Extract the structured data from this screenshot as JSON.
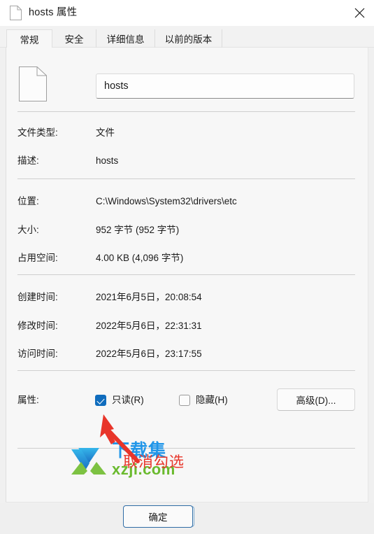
{
  "window": {
    "title": "hosts 属性",
    "title_icon": "document-icon",
    "close_label": "×"
  },
  "tabs": [
    {
      "label": "常规",
      "active": true
    },
    {
      "label": "安全",
      "active": false
    },
    {
      "label": "详细信息",
      "active": false
    },
    {
      "label": "以前的版本",
      "active": false
    }
  ],
  "header": {
    "file_icon": "document-icon",
    "filename_value": "hosts",
    "filename_placeholder": "hosts"
  },
  "properties": [
    {
      "id": "type",
      "label": "文件类型:",
      "value": "文件"
    },
    {
      "id": "desc",
      "label": "描述:",
      "value": "hosts"
    },
    {
      "id": "loc",
      "label": "位置:",
      "value": "C:\\Windows\\System32\\drivers\\etc"
    },
    {
      "id": "size",
      "label": "大小:",
      "value": "952 字节 (952 字节)"
    },
    {
      "id": "disk",
      "label": "占用空间:",
      "value": "4.00 KB (4,096 字节)"
    },
    {
      "id": "created",
      "label": "创建时间:",
      "value": "2021年6月5日，20:08:54"
    },
    {
      "id": "modified",
      "label": "修改时间:",
      "value": "2022年5月6日，22:31:31"
    },
    {
      "id": "accessed",
      "label": "访问时间:",
      "value": "2022年5月6日，23:17:55"
    }
  ],
  "attributes": {
    "label": "属性:",
    "readonly": {
      "label": "只读(R)",
      "checked": true
    },
    "hidden": {
      "label": "隐藏(H)",
      "checked": false
    },
    "advanced_button": "高级(D)..."
  },
  "footer": {
    "ok_button": "确定"
  },
  "annotation": {
    "text": "取消勾选",
    "color": "#e8352a",
    "arrow": "red-arrow-up-left"
  },
  "watermark": {
    "main_text": "下载集",
    "sub_text": "xzji.com",
    "main_color": "#2196e8",
    "sub_color": "#6aba2e"
  },
  "colors": {
    "accent": "#0f6cbd",
    "dialog_bg": "#f0f0f0",
    "panel_bg": "#f7f7f7",
    "titlebar_bg": "#ffffff",
    "text": "#1b1b1b"
  }
}
